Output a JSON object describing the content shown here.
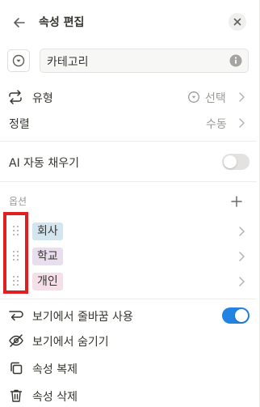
{
  "header": {
    "title": "속성 편집",
    "back_icon": "arrow-left-icon",
    "close_icon": "close-icon"
  },
  "property": {
    "name_value": "카테고리",
    "type_icon": "select-circle-icon",
    "info_icon": "info-icon"
  },
  "settings": {
    "type_label": "유형",
    "type_value": "선택",
    "sort_label": "정렬",
    "sort_value": "수동",
    "autofill_label": "AI 자동 채우기",
    "autofill_on": false
  },
  "options": {
    "section_label": "옵션",
    "items": [
      {
        "label": "회사",
        "color": "#d3e5ef"
      },
      {
        "label": "학교",
        "color": "#e8deee"
      },
      {
        "label": "개인",
        "color": "#f5e0e9"
      }
    ]
  },
  "actions": {
    "wrap_label": "보기에서 줄바꿈 사용",
    "wrap_on": true,
    "hide_label": "보기에서 숨기기",
    "duplicate_label": "속성 복제",
    "delete_label": "속성 삭제"
  },
  "colors": {
    "accent": "#2383e2",
    "highlight": "#e02020"
  }
}
